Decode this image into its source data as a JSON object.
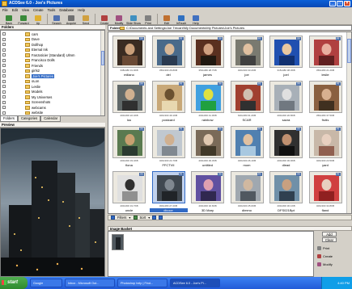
{
  "window": {
    "title": "ACDSee 6.0 - Joe's Pictures"
  },
  "menu": [
    "File",
    "Edit",
    "View",
    "Create",
    "Tools",
    "Database",
    "Help"
  ],
  "toolbar": [
    {
      "label": "Back",
      "icon": "back-arrow-icon",
      "color": "#3a8a3a"
    },
    {
      "label": "Forward",
      "icon": "forward-arrow-icon",
      "color": "#3a8a3a"
    },
    {
      "label": "Up",
      "icon": "up-folder-icon",
      "color": "#e0b030"
    },
    {
      "label": "Search",
      "icon": "search-icon",
      "color": "#5070b0"
    },
    {
      "label": "Acquire",
      "icon": "camera-icon",
      "color": "#707070"
    },
    {
      "label": "Send",
      "icon": "envelope-icon",
      "color": "#d0a040"
    },
    {
      "label": "Create",
      "icon": "wand-icon",
      "color": "#b04040"
    },
    {
      "label": "Modify",
      "icon": "brush-icon",
      "color": "#a05080"
    },
    {
      "label": "Slide Show",
      "icon": "slideshow-icon",
      "color": "#4090c0"
    },
    {
      "label": "Print",
      "icon": "printer-icon",
      "color": "#808080"
    },
    {
      "label": "Edit",
      "icon": "pencil-icon",
      "color": "#c07030"
    },
    {
      "label": "InTouch",
      "icon": "globe-icon",
      "color": "#3070c0"
    },
    {
      "label": "Help",
      "icon": "help-icon",
      "color": "#4070c0"
    }
  ],
  "folders": {
    "title": "Folders",
    "items": [
      "cars",
      "Dave",
      "Dollhop",
      "Eternal Ink",
      "Fanzaticier (Standard) Ulmm",
      "Francisco Dolls",
      "Friends",
      "girls2",
      "Joe's Pictures",
      "oLon",
      "Leslie",
      "Models",
      "My Universes",
      "Screenshots",
      "webcams",
      "website",
      "Workshops"
    ],
    "selected_index": 8,
    "tabs": [
      "Folders",
      "Categories",
      "Calendar"
    ]
  },
  "preview": {
    "title": "Preview"
  },
  "address": {
    "label": "Folders",
    "path": "C:\\Documents and Settings\\Joe Trecani\\My Documents\\My Pictures\\Joe's Pictures"
  },
  "thumbnails": [
    {
      "caption": "miliano",
      "meta": "338x480 31.9KB",
      "colors": [
        "#3a2c22",
        "#caa07a",
        "#6a4a35"
      ]
    },
    {
      "caption": "del",
      "meta": "350x300 26.8KB",
      "colors": [
        "#4a6a8a",
        "#d8b898",
        "#2a3a50"
      ]
    },
    {
      "caption": "james",
      "meta": "350x480 28.7KB",
      "colors": [
        "#5a3020",
        "#d0a080",
        "#201810"
      ]
    },
    {
      "caption": "joe",
      "meta": "400x300 33.2KB",
      "colors": [
        "#7a7a70",
        "#e0c0a0",
        "#404040"
      ]
    },
    {
      "caption": "joel",
      "meta": "315x480 38.3KB",
      "colors": [
        "#2050b0",
        "#e8c8a0",
        "#103070"
      ]
    },
    {
      "caption": "leslie",
      "meta": "350x480 21.2KB",
      "colors": [
        "#b04040",
        "#e8b0a0",
        "#602020"
      ]
    },
    {
      "caption": "lou",
      "meta": "400x300 22.4KB",
      "colors": [
        "#606868",
        "#d0b090",
        "#303030"
      ]
    },
    {
      "caption": "postcard",
      "meta": "400x300 49.1KB",
      "colors": [
        "#c8a878",
        "#6a5030",
        "#e8d8b0"
      ]
    },
    {
      "caption": "rainbow",
      "meta": "400x300 41.0KB",
      "colors": [
        "#40a0e0",
        "#e0e040",
        "#20a040"
      ]
    },
    {
      "caption": "SCAR",
      "meta": "640x480 61.2KB",
      "colors": [
        "#a04030",
        "#d0c0b0",
        "#303030"
      ]
    },
    {
      "caption": "sacra",
      "meta": "400x300 20.8KB",
      "colors": [
        "#a8b0b8",
        "#e0e0e0",
        "#707880"
      ]
    },
    {
      "caption": "frutis",
      "meta": "350x480 37.5KB",
      "colors": [
        "#8a6040",
        "#d8b090",
        "#403020"
      ]
    },
    {
      "caption": "fiona",
      "meta": "400x300 33.4KB",
      "colors": [
        "#5a7a50",
        "#c8a070",
        "#2a3a30"
      ]
    },
    {
      "caption": "FFCTVII",
      "meta": "400x300 24.7KB",
      "colors": [
        "#c0c8d0",
        "#d0b090",
        "#808890"
      ]
    },
    {
      "caption": "untitled",
      "meta": "400x300 29.3KB",
      "colors": [
        "#7a6a58",
        "#e0c8b0",
        "#403828"
      ]
    },
    {
      "caption": "mom",
      "meta": "400x300 26.1KB",
      "colors": [
        "#5080b0",
        "#e0c0a0",
        "#a8c8e0"
      ]
    },
    {
      "caption": "dlead",
      "meta": "400x300 36.9KB",
      "colors": [
        "#303030",
        "#c09070",
        "#101010"
      ]
    },
    {
      "caption": "yard",
      "meta": "400x300 23.5KB",
      "colors": [
        "#c8b8a8",
        "#e8d0c0",
        "#906050"
      ]
    },
    {
      "caption": "uncle",
      "meta": "400x300 19.7KB",
      "colors": [
        "#e0e0e0",
        "#303030",
        "#909090"
      ]
    },
    {
      "caption": "dicoce",
      "meta": "300x480 27.2KB",
      "colors": [
        "#404850",
        "#808890",
        "#202428"
      ],
      "selected": true
    },
    {
      "caption": "3D Mary",
      "meta": "400x300 32.6KB",
      "colors": [
        "#6050a0",
        "#e0a0b0",
        "#302850"
      ]
    },
    {
      "caption": "dimmo",
      "meta": "400x300 25.0KB",
      "colors": [
        "#a0a8b0",
        "#d0b8a0",
        "#505860"
      ]
    },
    {
      "caption": "DFS021Bpt",
      "meta": "400x300 30.1KB",
      "colors": [
        "#7090a8",
        "#c8a080",
        "#304050"
      ]
    },
    {
      "caption": "fland",
      "meta": "400x300 34.8KB",
      "colors": [
        "#d04040",
        "#e8d0c0",
        "#902020"
      ]
    }
  ],
  "filterbar": {
    "filters_label": "Filters",
    "sort_label": "Sort"
  },
  "basket": {
    "title": "Image Basket",
    "buttons": [
      "Add",
      "Clear"
    ],
    "actions": [
      "Print",
      "Create",
      "Modify"
    ]
  },
  "taskbar": {
    "start": "start",
    "items": [
      "Google",
      "Inbox - Microsoft Out...",
      "Photoshop help | Find...",
      "ACDSee 6.0 - Joe's Pi..."
    ],
    "active_index": 3,
    "clock": "4:40 PM"
  }
}
